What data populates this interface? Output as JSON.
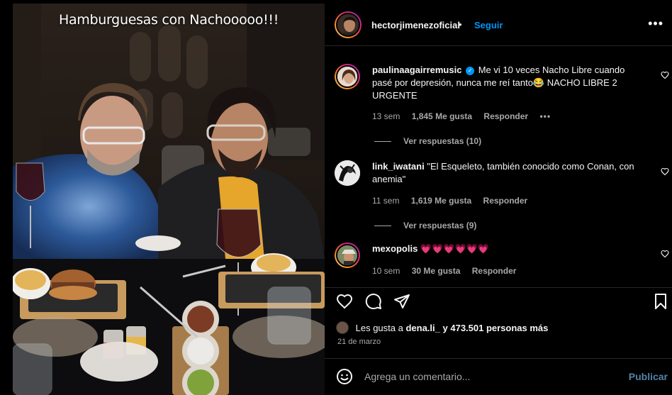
{
  "photo": {
    "caption": "Hamburguesas con Nachooooo!!!"
  },
  "header": {
    "username": "hectorjimenezoficial",
    "separator": "•",
    "follow_label": "Seguir",
    "more_label": "•••"
  },
  "comments": [
    {
      "username": "paulinaagairremusic",
      "verified": true,
      "text": "Me vi 10 veces Nacho Libre cuando pasé por depresión, nunca me reí tanto😂 NACHO LIBRE 2 URGENTE",
      "time": "13 sem",
      "likes": "1,845 Me gusta",
      "reply_label": "Responder",
      "more_label": "•••",
      "view_replies": "Ver respuestas (10)"
    },
    {
      "username": "link_iwatani",
      "verified": false,
      "text": "\"El Esqueleto, también conocido como Conan, con anemia\"",
      "time": "11 sem",
      "likes": "1,619 Me gusta",
      "reply_label": "Responder",
      "view_replies": "Ver respuestas (9)"
    },
    {
      "username": "mexopolis",
      "verified": false,
      "text": "💗💗💗💗💗💗",
      "time": "10 sem",
      "likes": "30 Me gusta",
      "reply_label": "Responder"
    }
  ],
  "post": {
    "likes_prefix": "Les gusta a",
    "likes_user": "dena.li_",
    "likes_suffix": "y 473.501 personas más",
    "date": "21 de marzo"
  },
  "composer": {
    "placeholder": "Agrega un comentario...",
    "publish_label": "Publicar"
  },
  "colors": {
    "accent": "#0095f6",
    "background": "#000000",
    "text": "#f5f5f5",
    "muted": "#a8a8a8"
  }
}
